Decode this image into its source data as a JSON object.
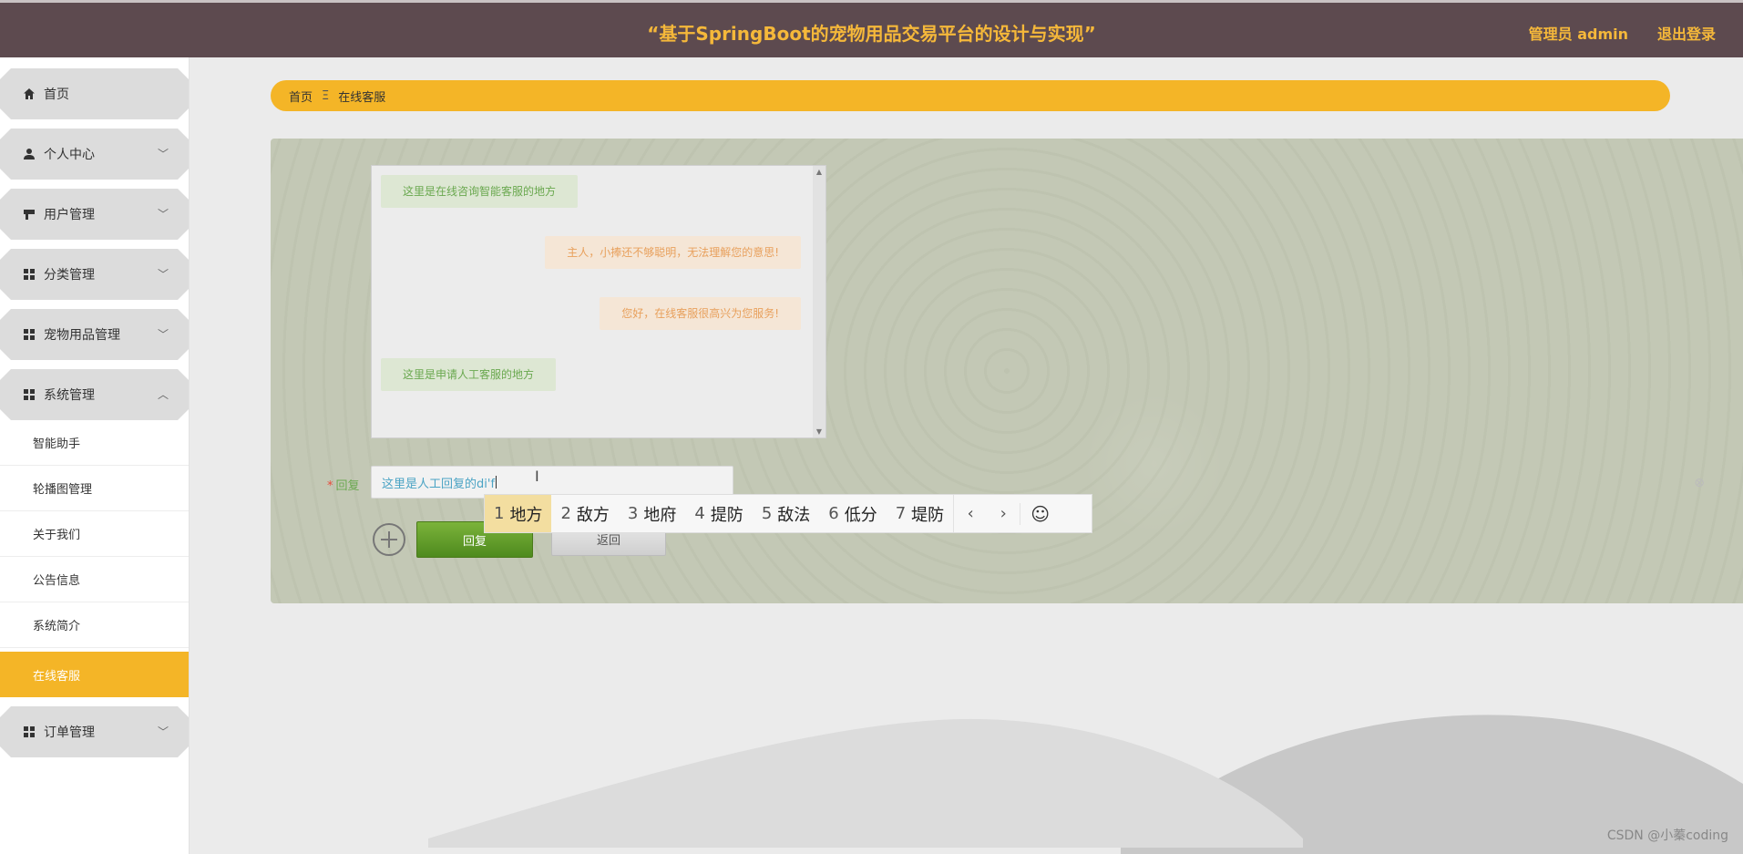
{
  "header": {
    "title": "“基于SpringBoot的宠物用品交易平台的设计与实现”",
    "admin_label": "管理员 admin",
    "logout_label": "退出登录"
  },
  "sidebar": {
    "items": [
      {
        "label": "首页",
        "icon": "home-icon"
      },
      {
        "label": "个人中心",
        "icon": "user-icon"
      },
      {
        "label": "用户管理",
        "icon": "user-manage-icon"
      },
      {
        "label": "分类管理",
        "icon": "grid-icon"
      },
      {
        "label": "宠物用品管理",
        "icon": "grid-icon"
      },
      {
        "label": "系统管理",
        "icon": "grid-icon"
      },
      {
        "label": "订单管理",
        "icon": "grid-icon"
      }
    ],
    "sub_items": [
      {
        "label": "智能助手"
      },
      {
        "label": "轮播图管理"
      },
      {
        "label": "关于我们"
      },
      {
        "label": "公告信息"
      },
      {
        "label": "系统简介"
      },
      {
        "label": "在线客服"
      }
    ],
    "active_sub_item": "在线客服"
  },
  "breadcrumb": {
    "home": "首页",
    "separator": "Ξ",
    "current": "在线客服"
  },
  "chat": {
    "messages": [
      {
        "side": "left",
        "text": "这里是在线咨询智能客服的地方"
      },
      {
        "side": "right",
        "text": "主人，小捧还不够聪明，无法理解您的意思!"
      },
      {
        "side": "right",
        "text": "您好，在线客服很高兴为您服务!"
      },
      {
        "side": "left",
        "text": "这里是申请人工客服的地方"
      }
    ]
  },
  "reply": {
    "label": "回复",
    "required_mark": "*",
    "input_value": "这里是人工回复的di'f",
    "reply_button": "回复",
    "back_button": "返回"
  },
  "ime": {
    "candidates": [
      {
        "num": "1",
        "text": "地方"
      },
      {
        "num": "2",
        "text": "敌方"
      },
      {
        "num": "3",
        "text": "地府"
      },
      {
        "num": "4",
        "text": "提防"
      },
      {
        "num": "5",
        "text": "敌法"
      },
      {
        "num": "6",
        "text": "低分"
      },
      {
        "num": "7",
        "text": "堤防"
      }
    ],
    "selected_index": 0
  },
  "watermark": "CSDN @小蓁coding",
  "colors": {
    "header_bg": "#5d4a4f",
    "accent": "#f4b527",
    "reply_green": "#6aa84f"
  }
}
